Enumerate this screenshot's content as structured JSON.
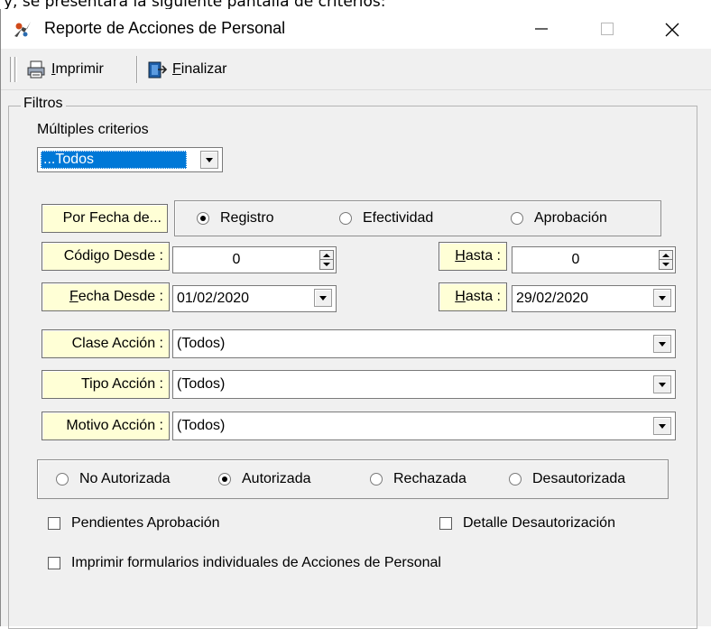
{
  "caption": "y, se presentará la siguiente pantalla de criterios:",
  "window": {
    "title": "Reporte de Acciones de Personal",
    "controls": {
      "minimize": "minimize-icon",
      "maximize": "maximize-icon",
      "close": "close-icon"
    }
  },
  "toolbar": {
    "print_prefix": "I",
    "print_rest": "mprimir",
    "finish_prefix": "F",
    "finish_rest": "inalizar"
  },
  "filters": {
    "group_title": "Filtros",
    "multi_label": "Múltiples criterios",
    "multi_value": "...Todos",
    "date_mode_label": "Por Fecha de...",
    "date_modes": [
      {
        "label": "Registro",
        "selected": true
      },
      {
        "label": "Efectividad",
        "selected": false
      },
      {
        "label": "Aprobación",
        "selected": false
      }
    ],
    "code_from_label": "Código Desde :",
    "code_from_value": "0",
    "code_to_prefix": "H",
    "code_to_rest": "asta :",
    "code_to_value": "0",
    "date_from_prefix": "F",
    "date_from_rest": "echa Desde :",
    "date_from_value": "01/02/2020",
    "date_to_prefix": "H",
    "date_to_rest": "asta :",
    "date_to_value": "29/02/2020",
    "action_class_label": "Clase Acción :",
    "action_class_value": "(Todos)",
    "action_type_label": "Tipo Acción :",
    "action_type_value": "(Todos)",
    "action_reason_label": "Motivo Acción :",
    "action_reason_value": "(Todos)",
    "statuses": [
      {
        "label": "No Autorizada",
        "selected": false
      },
      {
        "label": "Autorizada",
        "selected": true
      },
      {
        "label": "Rechazada",
        "selected": false
      },
      {
        "label": "Desautorizada",
        "selected": false
      }
    ],
    "pending_label": "Pendientes Aprobación",
    "pending_checked": false,
    "unauth_detail_label": "Detalle Desautorización",
    "unauth_detail_checked": false,
    "print_forms_label": "Imprimir formularios individuales de Acciones de Personal",
    "print_forms_checked": false
  },
  "colors": {
    "label_background": "#ffffd6",
    "selection": "#0078d7",
    "window_background": "#f0f0f0"
  }
}
